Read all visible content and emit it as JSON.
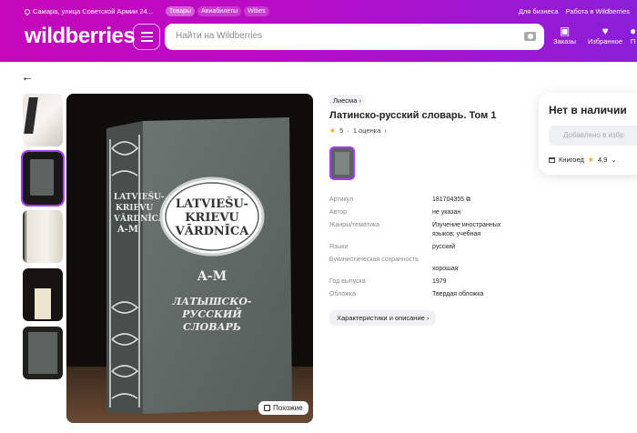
{
  "header": {
    "location": "Самара, улица Советской Армии 24...",
    "pills": [
      "Товары",
      "Авиабилеты",
      "Wibes"
    ],
    "links": [
      "Для бизнеса",
      "Работа в Wildberries"
    ],
    "logo": "wildberries",
    "search_placeholder": "Найти на Wildberries",
    "nav": [
      {
        "icon": "box-icon",
        "label": "Заказы"
      },
      {
        "icon": "heart-icon",
        "label": "Избранное"
      },
      {
        "icon": "profile-icon",
        "label": "П"
      }
    ]
  },
  "product": {
    "brand": "Лиесма",
    "title": "Латинско-русский словарь. Том 1",
    "rating": "5",
    "reviews": "1 оценка",
    "similar_label": "Похожие",
    "book_cover": {
      "line1": "LATVIEŠU-",
      "line2": "KRIEVU",
      "line3": "VĀRDNĪCA",
      "volume": "A-M",
      "ru1": "ЛАТЫШСКО-",
      "ru2": "РУССКИЙ",
      "ru3": "СЛОВАРЬ",
      "spine1": "LATVIEŠU-",
      "spine2": "KRIEVU",
      "spine3": "VĀRDNĪCA",
      "spine_volume": "A-M"
    },
    "specs": [
      {
        "key": "Артикул",
        "value": "181704355"
      },
      {
        "key": "Автор",
        "value": "не указан"
      },
      {
        "key": "Жанры/тематика",
        "value": "Изучение иностранных языков; учебная"
      },
      {
        "key": "Языки",
        "value": "русский"
      },
      {
        "key": "Букинистическая сохранность",
        "value": "хорошая"
      },
      {
        "key": "Год выпуска",
        "value": "1979"
      },
      {
        "key": "Обложка",
        "value": "Твердая обложка"
      }
    ],
    "chars_button": "Характеристики и описание"
  },
  "buybox": {
    "status": "Нет в наличии",
    "fav_button": "Добавлено в избр",
    "seller": "Книгоед",
    "seller_rating": "4,9"
  },
  "colors": {
    "brand_start": "#c507b9",
    "brand_end": "#8a1fd8",
    "accent": "#a73afd"
  }
}
